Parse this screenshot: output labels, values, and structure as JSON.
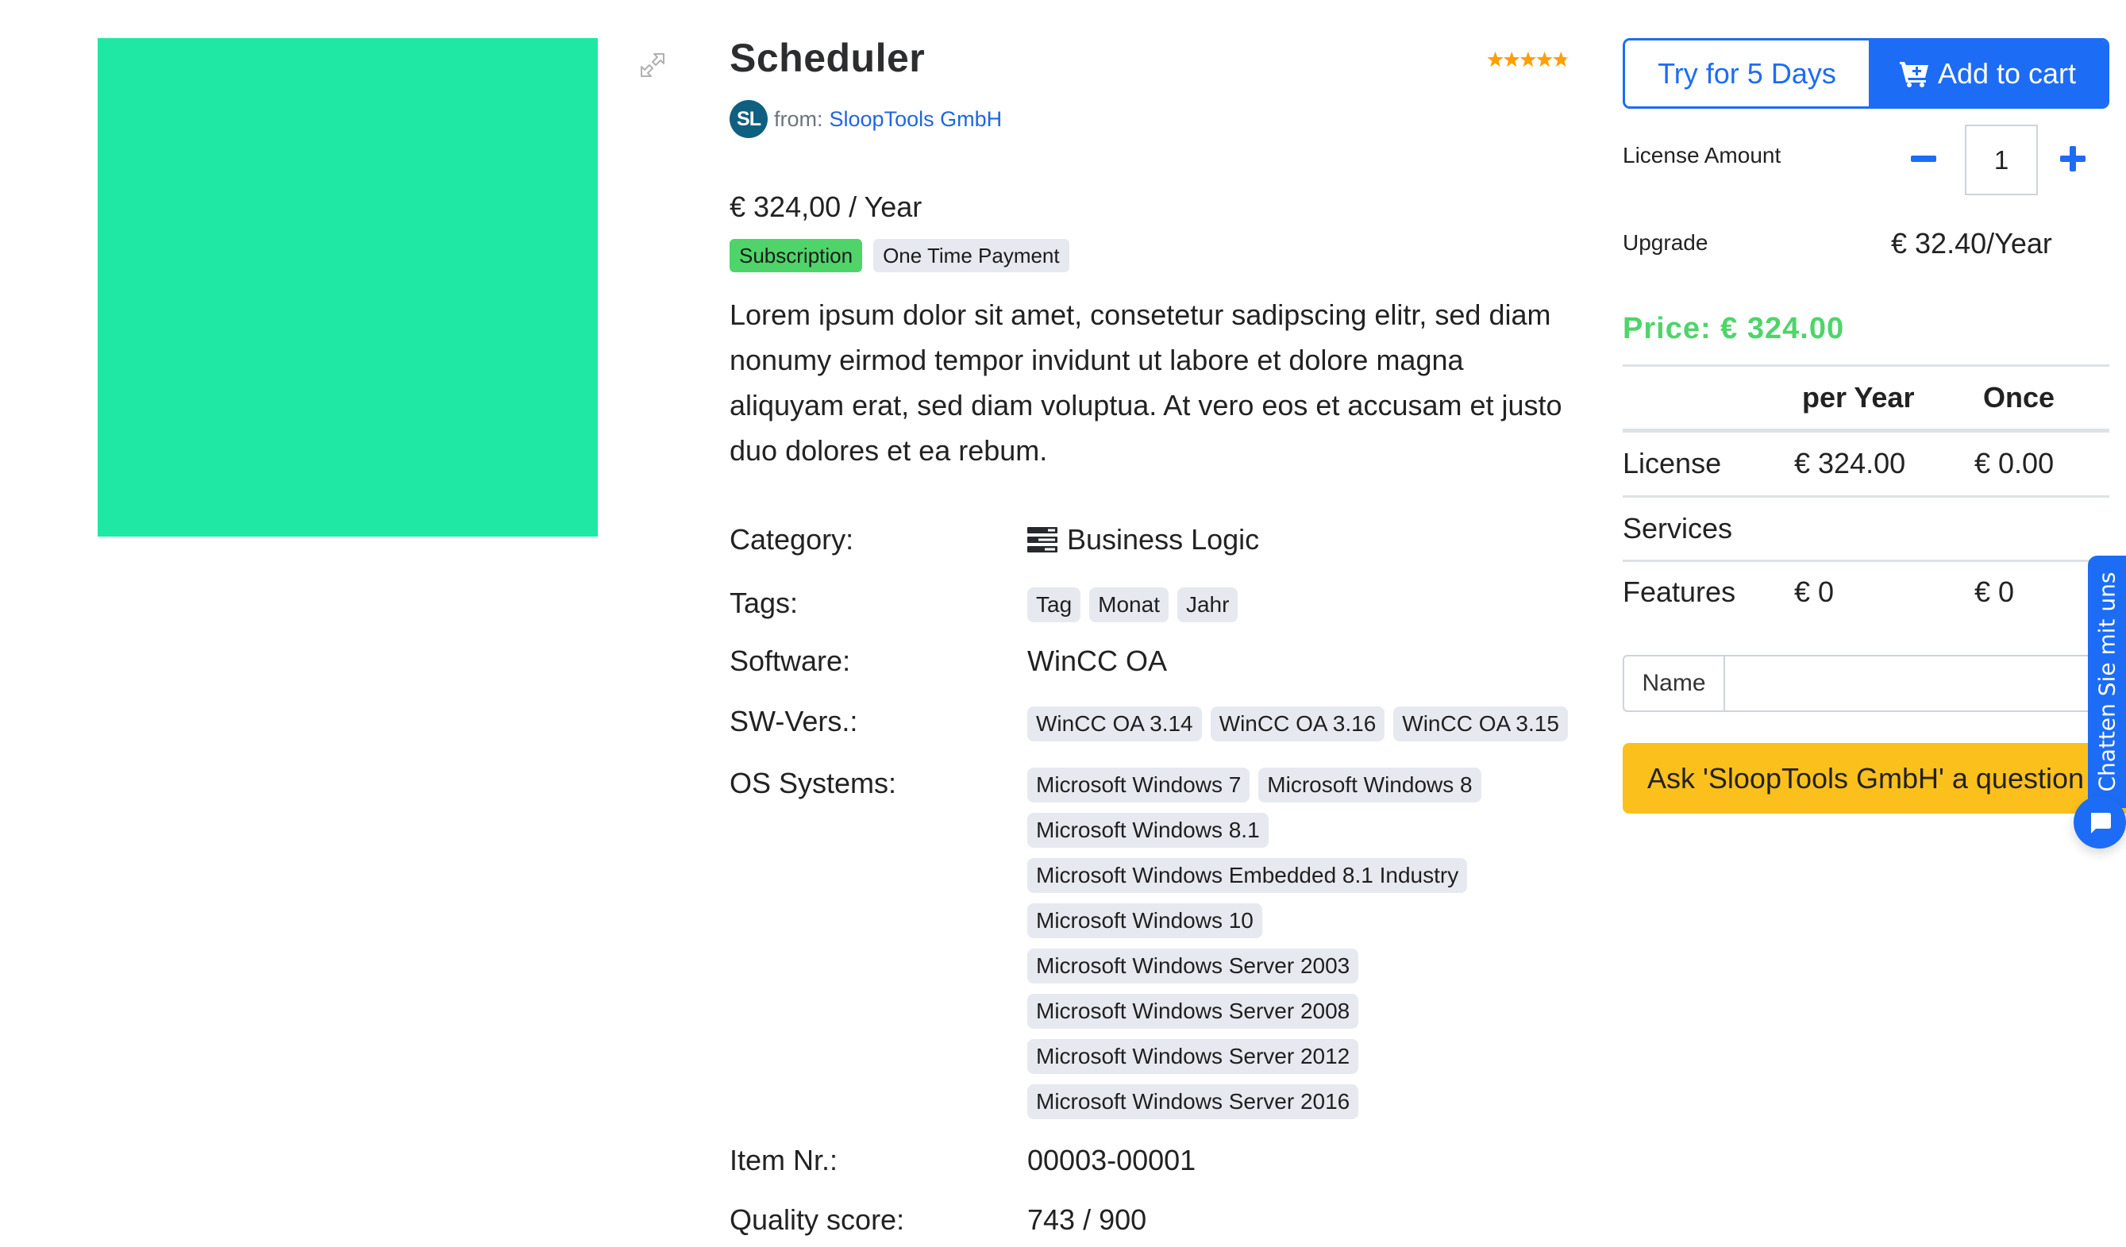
{
  "product": {
    "title": "Scheduler",
    "rating": {
      "value": 4.8,
      "max": 5,
      "color": "#ff9f00"
    },
    "image_icon": "calendar-check-stack-icon",
    "image_bg": "#1fe8a5",
    "expand_icon": "expand-arrows-icon",
    "vendor": {
      "avatar_initials": "SL",
      "from_label": "from:",
      "name": "SloopTools GmbH"
    },
    "price_line": "€ 324,00 / Year",
    "payment_types": [
      {
        "label": "Subscription",
        "active": true
      },
      {
        "label": "One Time Payment",
        "active": false
      }
    ],
    "description": "Lorem ipsum dolor sit amet, consetetur sadipscing elitr, sed diam nonumy eirmod tempor invidunt ut labore et dolore magna aliquyam erat, sed diam voluptua. At vero eos et accusam et justo duo dolores et ea rebum."
  },
  "details": {
    "category": {
      "label": "Category:",
      "icon": "server-stack-icon",
      "value": "Business Logic"
    },
    "tags": {
      "label": "Tags:",
      "values": [
        "Tag",
        "Monat",
        "Jahr"
      ]
    },
    "software": {
      "label": "Software:",
      "value": "WinCC OA"
    },
    "sw_versions": {
      "label": "SW-Vers.:",
      "values": [
        "WinCC OA 3.14",
        "WinCC OA 3.16",
        "WinCC OA 3.15"
      ]
    },
    "os_systems": {
      "label": "OS Systems:",
      "rows": [
        [
          "Microsoft Windows 7",
          "Microsoft Windows 8"
        ],
        [
          "Microsoft Windows 8.1"
        ],
        [
          "Microsoft Windows Embedded 8.1 Industry"
        ],
        [
          "Microsoft Windows 10"
        ],
        [
          "Microsoft Windows Server 2003"
        ],
        [
          "Microsoft Windows Server 2008"
        ],
        [
          "Microsoft Windows Server 2012"
        ],
        [
          "Microsoft Windows Server 2016"
        ]
      ]
    },
    "item_nr": {
      "label": "Item Nr.:",
      "value": "00003-00001"
    },
    "quality_score": {
      "label": "Quality score:",
      "value": "743 / 900"
    }
  },
  "purchase": {
    "try_label": "Try for 5 Days",
    "cart_label": "Add to cart",
    "cart_icon": "cart-plus-icon",
    "license_amount_label": "License Amount",
    "quantity": "1",
    "upgrade_label": "Upgrade",
    "upgrade_value": "€ 32.40/Year",
    "total_price": "Price: € 324.00",
    "accent": "#1d6cf5",
    "price_color": "#4fd46a",
    "table": {
      "headers": [
        "",
        "per Year",
        "Once"
      ],
      "rows": [
        [
          "License",
          "€ 324.00",
          "€ 0.00"
        ],
        [
          "Services",
          "",
          ""
        ],
        [
          "Features",
          "€ 0",
          "€ 0"
        ]
      ]
    },
    "question": {
      "name_label": "Name",
      "name_value": "",
      "ask_button": "Ask 'SloopTools GmbH' a question"
    }
  },
  "chat": {
    "tab_label": "Chatten Sie mit uns",
    "bubble_icon": "chat-bubble-icon"
  }
}
